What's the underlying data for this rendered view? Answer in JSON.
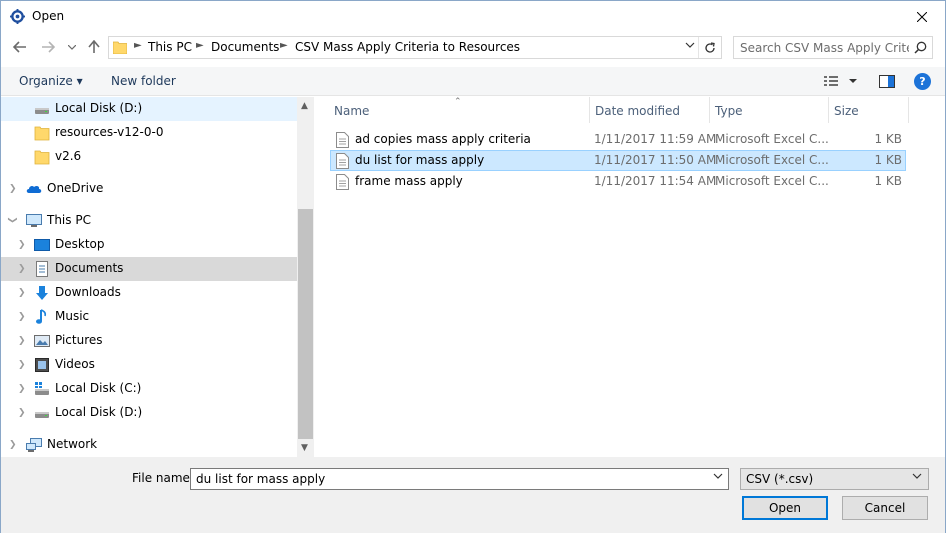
{
  "window": {
    "title": "Open"
  },
  "address": {
    "crumbs": [
      "This PC",
      "Documents",
      "CSV Mass Apply Criteria to Resources"
    ]
  },
  "search": {
    "placeholder": "Search CSV Mass Apply Criteri..."
  },
  "toolbar": {
    "organize_label": "Organize ▾",
    "new_folder_label": "New folder"
  },
  "nav": {
    "items": [
      {
        "label": "Local Disk (D:)",
        "icon": "drive-icon"
      },
      {
        "label": "resources-v12-0-0",
        "icon": "folder-icon"
      },
      {
        "label": "v2.6",
        "icon": "folder-icon"
      },
      {
        "label": "OneDrive",
        "icon": "onedrive-icon"
      },
      {
        "label": "This PC",
        "icon": "computer-icon"
      },
      {
        "label": "Desktop",
        "icon": "desktop-icon"
      },
      {
        "label": "Documents",
        "icon": "documents-icon"
      },
      {
        "label": "Downloads",
        "icon": "downloads-icon"
      },
      {
        "label": "Music",
        "icon": "music-icon"
      },
      {
        "label": "Pictures",
        "icon": "pictures-icon"
      },
      {
        "label": "Videos",
        "icon": "videos-icon"
      },
      {
        "label": "Local Disk (C:)",
        "icon": "drive-icon"
      },
      {
        "label": "Local Disk (D:)",
        "icon": "drive-icon"
      },
      {
        "label": "Network",
        "icon": "network-icon"
      }
    ]
  },
  "columns": {
    "name": "Name",
    "date": "Date modified",
    "type": "Type",
    "size": "Size"
  },
  "files": [
    {
      "name": "ad copies mass apply criteria",
      "date": "1/11/2017 11:59 AM",
      "type": "Microsoft Excel C...",
      "size": "1 KB",
      "selected": false
    },
    {
      "name": "du list for mass apply",
      "date": "1/11/2017 11:50 AM",
      "type": "Microsoft Excel C...",
      "size": "1 KB",
      "selected": true
    },
    {
      "name": "frame mass apply",
      "date": "1/11/2017 11:54 AM",
      "type": "Microsoft Excel C...",
      "size": "1 KB",
      "selected": false
    }
  ],
  "bottom": {
    "filename_label": "File name:",
    "filename_value": "du list for mass apply",
    "filter_value": "CSV (*.csv)",
    "open_label": "Open",
    "cancel_label": "Cancel"
  },
  "colors": {
    "accent": "#0078d7",
    "selection": "#cce8ff",
    "help": "#1c73d8"
  }
}
